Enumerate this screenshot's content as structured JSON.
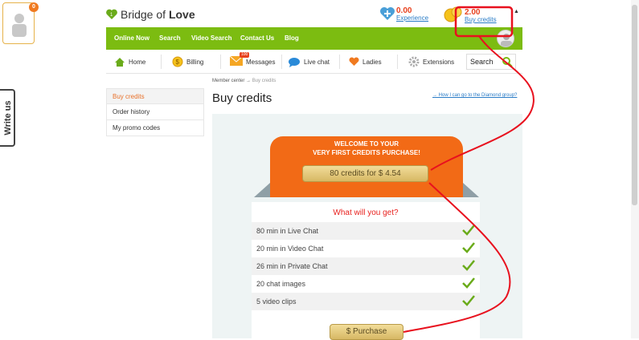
{
  "avatar_badge": "0",
  "write_us": "Write us",
  "logo": {
    "prefix": "Bridge of ",
    "bold": "Love"
  },
  "experience": {
    "value": "0.00",
    "label": "Experience"
  },
  "credits": {
    "value": "2.00",
    "label": "Buy credits"
  },
  "topnav": [
    "Online Now",
    "Search",
    "Video Search",
    "Contact Us",
    "Blog"
  ],
  "menu": {
    "home": "Home",
    "billing": "Billing",
    "messages": "Messages",
    "messages_badge": "100",
    "live_chat": "Live chat",
    "ladies": "Ladies",
    "extensions": "Extensions"
  },
  "search": {
    "placeholder": "Search"
  },
  "sidebar": [
    "Buy credits",
    "Order history",
    "My promo codes"
  ],
  "breadcrumb": {
    "root": "Member center",
    "arrow": "→",
    "current": "Buy credits"
  },
  "page_title": "Buy credits",
  "diamond_link": "→ How I can go to the Diamond group?",
  "welcome": {
    "line1": "WELCOME TO YOUR",
    "line2": "VERY FIRST CREDITS PURCHASE!"
  },
  "offer": "80 credits for $ 4.54",
  "benefits_title": "What will you get?",
  "benefits": [
    "80 min in Live Chat",
    "20 min in Video Chat",
    "26 min in Private Chat",
    "20 chat images",
    "5 video clips"
  ],
  "purchase": "$ Purchase",
  "colors": {
    "green": "#7cbc11",
    "orange": "#f26a16",
    "annotation": "#e8111e"
  }
}
